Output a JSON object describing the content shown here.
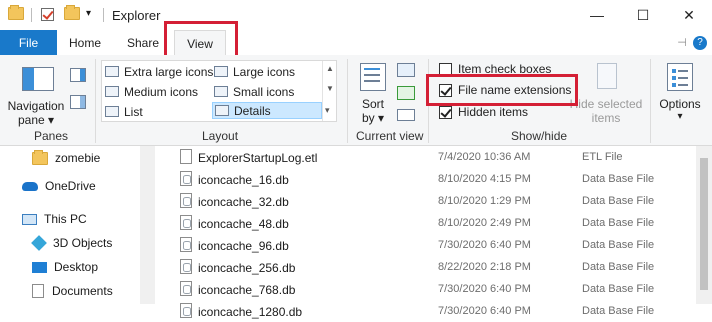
{
  "title": "Explorer",
  "tabs": {
    "file": "File",
    "home": "Home",
    "share": "Share",
    "view": "View"
  },
  "window_buttons": {
    "minimize": "—",
    "maximize": "☐",
    "close": "✕",
    "help": "?",
    "pin": "⊣"
  },
  "ribbon": {
    "panes": {
      "nav_pane_line1": "Navigation",
      "nav_pane_line2": "pane ▾",
      "group": "Panes"
    },
    "layout": {
      "items": [
        "Extra large icons",
        "Large icons",
        "Medium icons",
        "Small icons",
        "List",
        "Details"
      ],
      "selected": "Details",
      "group": "Layout"
    },
    "current_view": {
      "sort_line1": "Sort",
      "sort_line2": "by ▾",
      "group": "Current view"
    },
    "show_hide": {
      "item_check_boxes": "Item check boxes",
      "file_name_extensions": "File name extensions",
      "hidden_items": "Hidden items",
      "hide_selected": "Hide selected",
      "items": "items",
      "group": "Show/hide",
      "states": {
        "item_check_boxes": false,
        "file_name_extensions": true,
        "hidden_items": true
      }
    },
    "options": {
      "label": "Options",
      "arrow": "▾"
    }
  },
  "nav_pane": [
    "zomebie",
    "OneDrive",
    "This PC",
    "3D Objects",
    "Desktop",
    "Documents"
  ],
  "files": [
    {
      "name": "ExplorerStartupLog.etl",
      "date": "7/4/2020 10:36 AM",
      "type": "ETL File"
    },
    {
      "name": "iconcache_16.db",
      "date": "8/10/2020 4:15 PM",
      "type": "Data Base File"
    },
    {
      "name": "iconcache_32.db",
      "date": "8/10/2020 1:29 PM",
      "type": "Data Base File"
    },
    {
      "name": "iconcache_48.db",
      "date": "8/10/2020 2:49 PM",
      "type": "Data Base File"
    },
    {
      "name": "iconcache_96.db",
      "date": "7/30/2020 6:40 PM",
      "type": "Data Base File"
    },
    {
      "name": "iconcache_256.db",
      "date": "8/22/2020 2:18 PM",
      "type": "Data Base File"
    },
    {
      "name": "iconcache_768.db",
      "date": "7/30/2020 6:40 PM",
      "type": "Data Base File"
    },
    {
      "name": "iconcache_1280.db",
      "date": "7/30/2020 6:40 PM",
      "type": "Data Base File"
    }
  ],
  "colors": {
    "accent": "#1979ca",
    "highlight": "#d41f35",
    "selected": "#cce8ff"
  }
}
